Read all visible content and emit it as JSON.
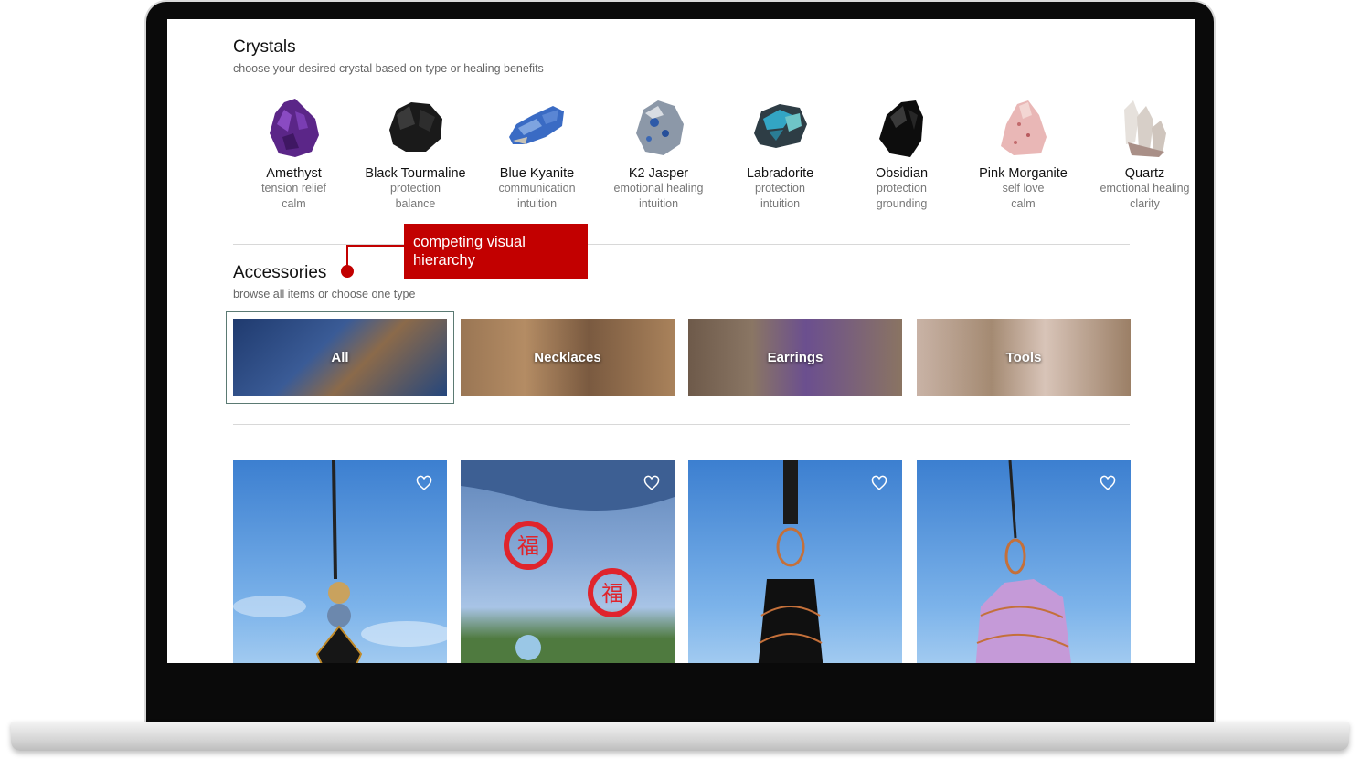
{
  "crystals": {
    "title": "Crystals",
    "subtitle": "choose your desired crystal based on type or healing benefits",
    "items": [
      {
        "name": "Amethyst",
        "tag1": "tension relief",
        "tag2": "calm",
        "color": "#6a2d9c"
      },
      {
        "name": "Black Tourmaline",
        "tag1": "protection",
        "tag2": "balance",
        "color": "#1c1c1c"
      },
      {
        "name": "Blue Kyanite",
        "tag1": "communication",
        "tag2": "intuition",
        "color": "#3a6bc4"
      },
      {
        "name": "K2 Jasper",
        "tag1": "emotional healing",
        "tag2": "intuition",
        "color": "#8795a6"
      },
      {
        "name": "Labradorite",
        "tag1": "protection",
        "tag2": "intuition",
        "color": "#2f8fa8"
      },
      {
        "name": "Obsidian",
        "tag1": "protection",
        "tag2": "grounding",
        "color": "#111111"
      },
      {
        "name": "Pink Morganite",
        "tag1": "self love",
        "tag2": "calm",
        "color": "#e7b3b5"
      },
      {
        "name": "Quartz",
        "tag1": "emotional healing",
        "tag2": "clarity",
        "color": "#d8cfc7"
      }
    ]
  },
  "accessories": {
    "title": "Accessories",
    "subtitle": "browse all items or choose one type",
    "categories": [
      {
        "label": "All",
        "selected": true
      },
      {
        "label": "Necklaces",
        "selected": false
      },
      {
        "label": "Earrings",
        "selected": false
      },
      {
        "label": "Tools",
        "selected": false
      }
    ]
  },
  "annotation": {
    "text": "competing visual hierarchy",
    "color": "#c20000"
  },
  "products": {
    "count_visible": 4,
    "favorite_icon": "heart-icon"
  }
}
